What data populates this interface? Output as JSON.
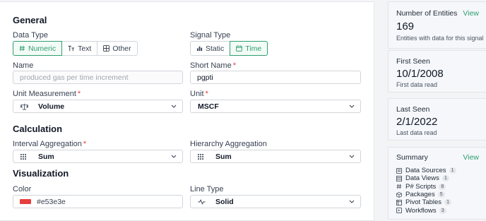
{
  "general": {
    "title": "General",
    "data_type": {
      "label": "Data Type",
      "options": [
        {
          "icon": "hash-icon",
          "label": "Numeric",
          "active": true
        },
        {
          "icon": "text-icon",
          "label": "Text",
          "active": false
        },
        {
          "icon": "grid-icon",
          "label": "Other",
          "active": false
        }
      ]
    },
    "signal_type": {
      "label": "Signal Type",
      "options": [
        {
          "icon": "bar-chart-icon",
          "label": "Static",
          "active": false
        },
        {
          "icon": "calendar-icon",
          "label": "Time",
          "active": true
        }
      ]
    },
    "name": {
      "label": "Name",
      "value": "",
      "placeholder": "produced gas per time increment"
    },
    "short_name": {
      "label": "Short Name",
      "required_mark": "*",
      "value": "pgpti"
    },
    "unit_measurement": {
      "label": "Unit Measurement",
      "required_mark": "*",
      "value": "Volume",
      "icon": "scale-icon"
    },
    "unit": {
      "label": "Unit",
      "required_mark": "*",
      "value": "MSCF"
    }
  },
  "calculation": {
    "title": "Calculation",
    "interval_aggregation": {
      "label": "Interval Aggregation",
      "required_mark": "*",
      "value": "Sum",
      "icon": "grid-dots-icon"
    },
    "hierarchy_aggregation": {
      "label": "Hierarchy Aggregation",
      "value": "Sum",
      "icon": "grid-dots-icon"
    }
  },
  "visualization": {
    "title": "Visualization",
    "color": {
      "label": "Color",
      "value": "#e53e3e",
      "swatch": "#e53e3e"
    },
    "line_type": {
      "label": "Line Type",
      "value": "Solid",
      "icon": "line-chart-icon"
    }
  },
  "sidebar": {
    "entities": {
      "title": "Number of Entities",
      "link": "View",
      "value": "169",
      "sub": "Entities with data for this signal"
    },
    "first_seen": {
      "title": "First Seen",
      "value": "10/1/2008",
      "sub": "First data read"
    },
    "last_seen": {
      "title": "Last Seen",
      "value": "2/1/2022",
      "sub": "Last data read"
    },
    "summary": {
      "title": "Summary",
      "link": "View",
      "items": [
        {
          "icon": "data-source-icon",
          "label": "Data Sources",
          "count": "1"
        },
        {
          "icon": "table-icon",
          "label": "Data Views",
          "count": "1"
        },
        {
          "icon": "hash-icon",
          "label": "P# Scripts",
          "count": "8"
        },
        {
          "icon": "package-icon",
          "label": "Packages",
          "count": "5"
        },
        {
          "icon": "table-icon",
          "label": "Pivot Tables",
          "count": "1"
        },
        {
          "icon": "workflow-icon",
          "label": "Workflows",
          "count": "3"
        }
      ]
    }
  },
  "colors": {
    "accent": "#2f9e6e",
    "required": "#e53e3e"
  }
}
